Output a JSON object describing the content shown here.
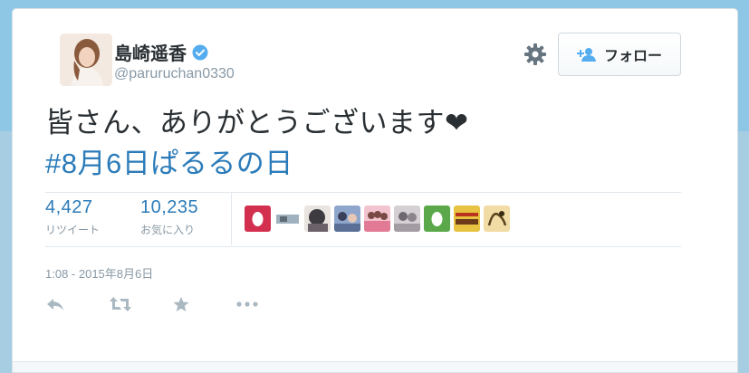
{
  "user": {
    "display_name": "島崎遥香",
    "screen_name": "@paruruchan0330",
    "verified": true
  },
  "follow_button": {
    "label": "フォロー",
    "icon": "add-person-icon"
  },
  "settings": {
    "icon": "gear-icon"
  },
  "tweet": {
    "text": "皆さん、ありがとうございます❤",
    "hashtag": "#8月6日ぱるるの日"
  },
  "stats": {
    "retweets": {
      "count": "4,427",
      "label": "リツイート"
    },
    "favorites": {
      "count": "10,235",
      "label": "お気に入り"
    }
  },
  "favoriters": [
    {
      "name": "avatar-red-egg",
      "color": "#d32f4f"
    },
    {
      "name": "avatar-photo-1",
      "color": "#b9c4cc"
    },
    {
      "name": "avatar-photo-2",
      "color": "#4b4a4f"
    },
    {
      "name": "avatar-photo-3",
      "color": "#7c8fb3"
    },
    {
      "name": "avatar-photo-4",
      "color": "#e89aa8"
    },
    {
      "name": "avatar-photo-5",
      "color": "#b7b1b6"
    },
    {
      "name": "avatar-green-egg",
      "color": "#5aa84a"
    },
    {
      "name": "avatar-photo-6",
      "color": "#c9a632"
    },
    {
      "name": "avatar-photo-7",
      "color": "#d8b56a"
    }
  ],
  "timestamp": "1:08 - 2015年8月6日",
  "actions": [
    "reply-icon",
    "retweet-icon",
    "favorite-icon",
    "more-icon"
  ],
  "colors": {
    "link": "#2b7bb9",
    "muted": "#8899a6",
    "text": "#292f33",
    "verified": "#55acee"
  }
}
